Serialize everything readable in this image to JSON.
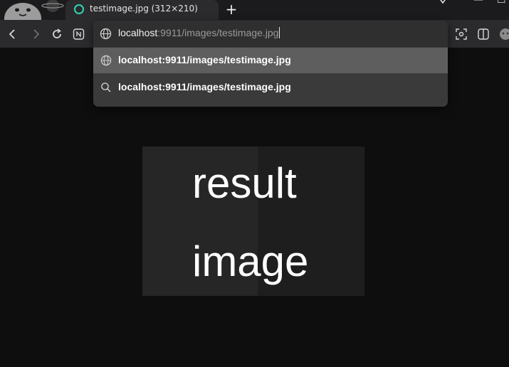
{
  "tab": {
    "title": "testimage.jpg (312×210)",
    "new_tab_label": "+"
  },
  "window": {
    "minimize_label": "—",
    "maximize_label": "☐"
  },
  "address_bar": {
    "host": "localhost",
    "rest": ":9911/images/testimage.jpg"
  },
  "suggestions": [
    {
      "text": "localhost:9911/images/testimage.jpg",
      "icon": "globe-icon",
      "selected": true
    },
    {
      "text": "localhost:9911/images/testimage.jpg",
      "icon": "search-icon",
      "selected": false
    }
  ],
  "image": {
    "line1": "result",
    "line2": "image"
  },
  "colors": {
    "accent": "#2fd4b4",
    "page_bg": "#0e0e0e",
    "toolbar_bg": "#2b2b2d",
    "selected_suggestion_bg": "#5e5e5e"
  }
}
